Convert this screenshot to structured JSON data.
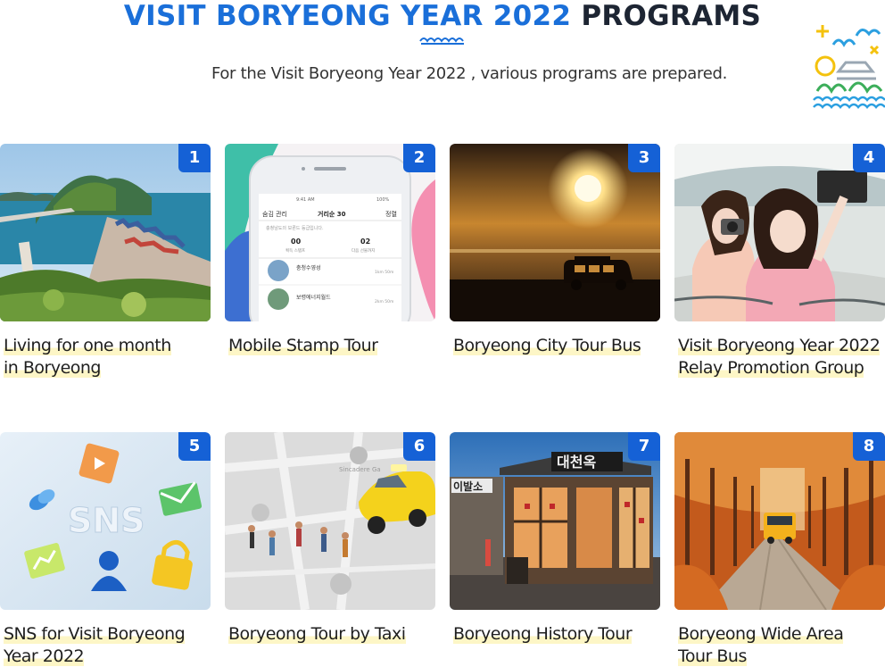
{
  "header": {
    "title_highlight": "VISIT BORYEONG YEAR 2022",
    "title_rest": "PROGRAMS",
    "subtitle": "For the Visit Boryeong Year 2022 , various programs are prepared."
  },
  "colors": {
    "accent": "#1a6fd9",
    "badge": "#1561d6",
    "title_dark": "#1d2533",
    "label_highlight": "#fdf6c6"
  },
  "programs": [
    {
      "number": "1",
      "line1": "Living for one month",
      "line2": "in Boryeong"
    },
    {
      "number": "2",
      "line1": "Mobile Stamp Tour",
      "line2": ""
    },
    {
      "number": "3",
      "line1": "Boryeong City Tour Bus",
      "line2": ""
    },
    {
      "number": "4",
      "line1": "Visit Boryeong Year 2022",
      "line2": "Relay Promotion Group"
    },
    {
      "number": "5",
      "line1": "SNS for Visit Boryeong",
      "line2": "Year 2022"
    },
    {
      "number": "6",
      "line1": "Boryeong Tour by Taxi",
      "line2": ""
    },
    {
      "number": "7",
      "line1": "Boryeong History Tour",
      "line2": ""
    },
    {
      "number": "8",
      "line1": "Boryeong Wide Area",
      "line2": "Tour Bus"
    }
  ],
  "phone": {
    "header_left": "숨김 관리",
    "header_center": "거리순 30",
    "header_right": "정렬",
    "notice": "충청남도의 보론드 등급입니다.",
    "stat1_value": "00",
    "stat1_label": "획득 스탬프",
    "stat2_value": "02",
    "stat2_label": "다음 선물까지",
    "item1": "충청수영성",
    "item1_dist": "1km 50m",
    "item2": "보령에너지월드",
    "item2_dist": "2km 50m",
    "status_time": "9:41 AM",
    "status_batt": "100%"
  },
  "images": {
    "sns_text": "SNS",
    "sign_main": "대천옥",
    "sign_left": "이발소",
    "map_text": "Sincadere Ga"
  }
}
